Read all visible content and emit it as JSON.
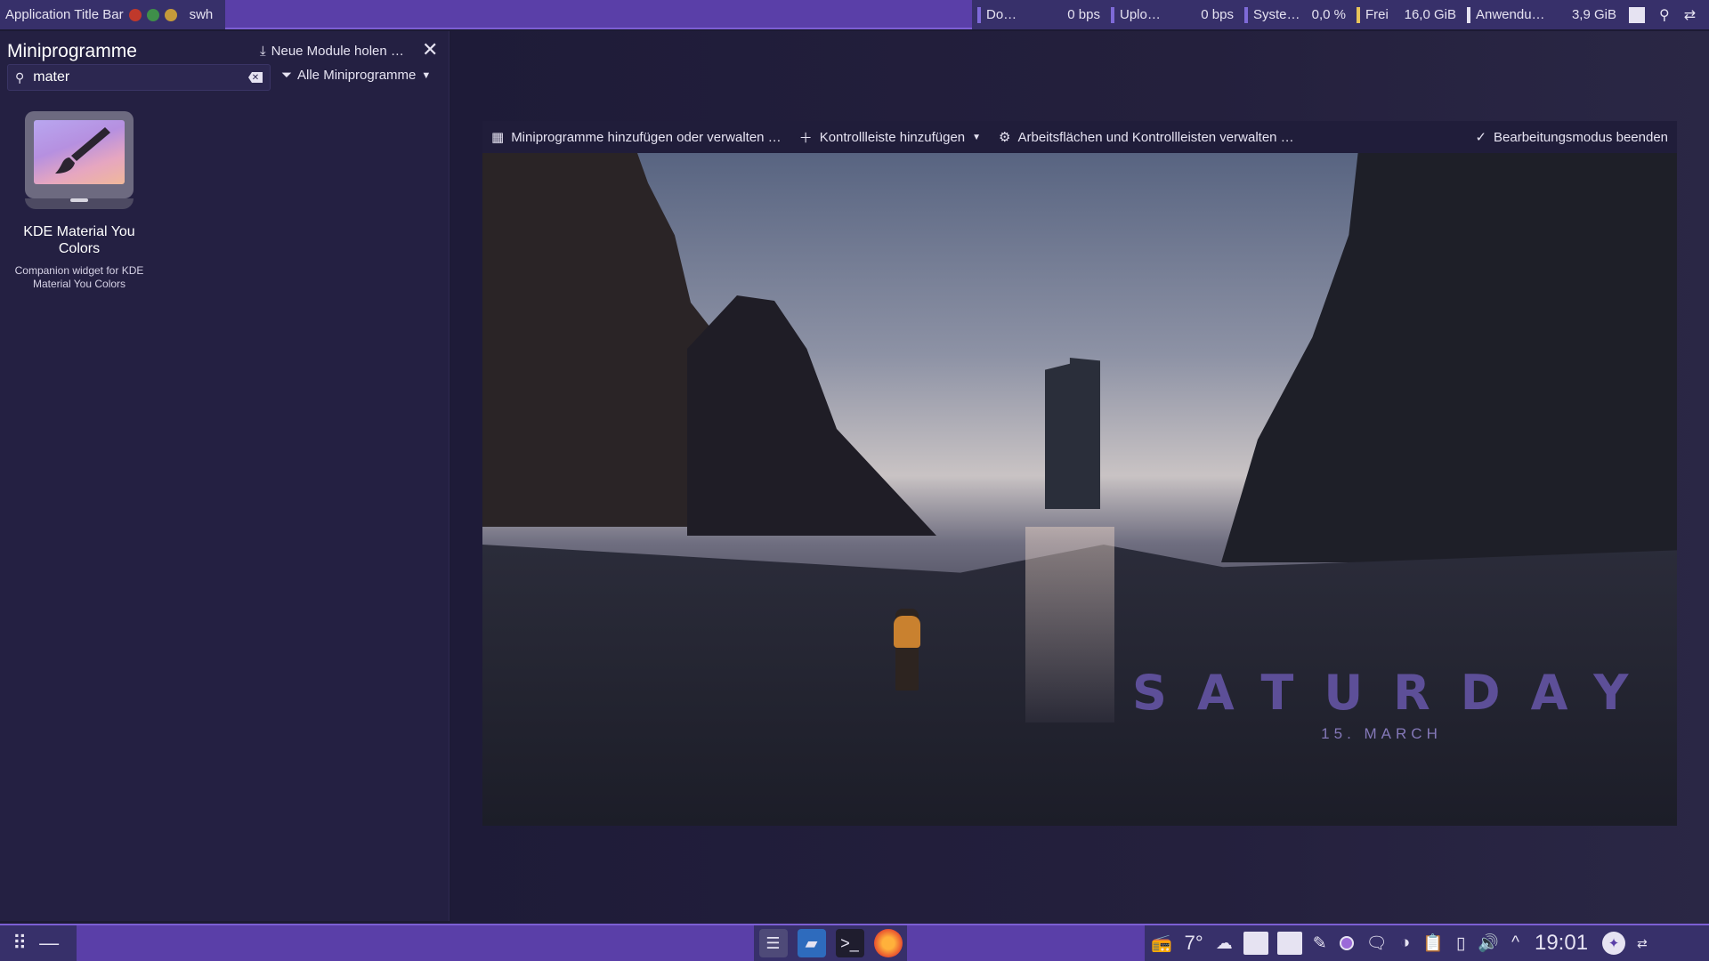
{
  "top_panel": {
    "title_applet": {
      "title": "Application Title Bar",
      "workspace": "swh"
    },
    "monitors": [
      {
        "label": "Do…",
        "value": "0 bps"
      },
      {
        "label": "Uplo…",
        "value": "0 bps"
      },
      {
        "label": "Syste…",
        "value": "0,0 %"
      },
      {
        "label": "Frei",
        "value": "16,0 GiB"
      },
      {
        "label": "Anwendu…",
        "value": "3,9 GiB"
      }
    ]
  },
  "sidebar": {
    "title": "Miniprogramme",
    "get_modules_label": "Neue Module holen …",
    "search": {
      "value": "mater"
    },
    "filter_label": "Alle Miniprogramme",
    "widgets": [
      {
        "name": "KDE Material You Colors",
        "description": "Companion widget for KDE Material You Colors"
      }
    ]
  },
  "edit_toolbar": {
    "manage_widgets": "Miniprogramme hinzufügen oder verwalten …",
    "add_panel": "Kontrollleiste hinzufügen",
    "manage_desktops": "Arbeitsflächen und Kontrollleisten verwalten …",
    "end_edit": "Bearbeitungsmodus beenden"
  },
  "wallpaper": {
    "day": "SATURDAY",
    "date": "15. MARCH"
  },
  "bottom_panel": {
    "temperature": "7°",
    "clock": "19:01"
  },
  "colors": {
    "panel": "#5a3fa8",
    "applet_bg": "#37306a",
    "sidebar_bg": "#242042",
    "accent": "#7c5fd3"
  },
  "icons": [
    "close-icon",
    "download-icon",
    "search-icon",
    "filter-icon",
    "gear-icon",
    "checkmark-icon",
    "plus-icon",
    "app-grid-icon",
    "minimize-icon",
    "weather-cloud-icon",
    "volume-icon",
    "clock-icon"
  ]
}
